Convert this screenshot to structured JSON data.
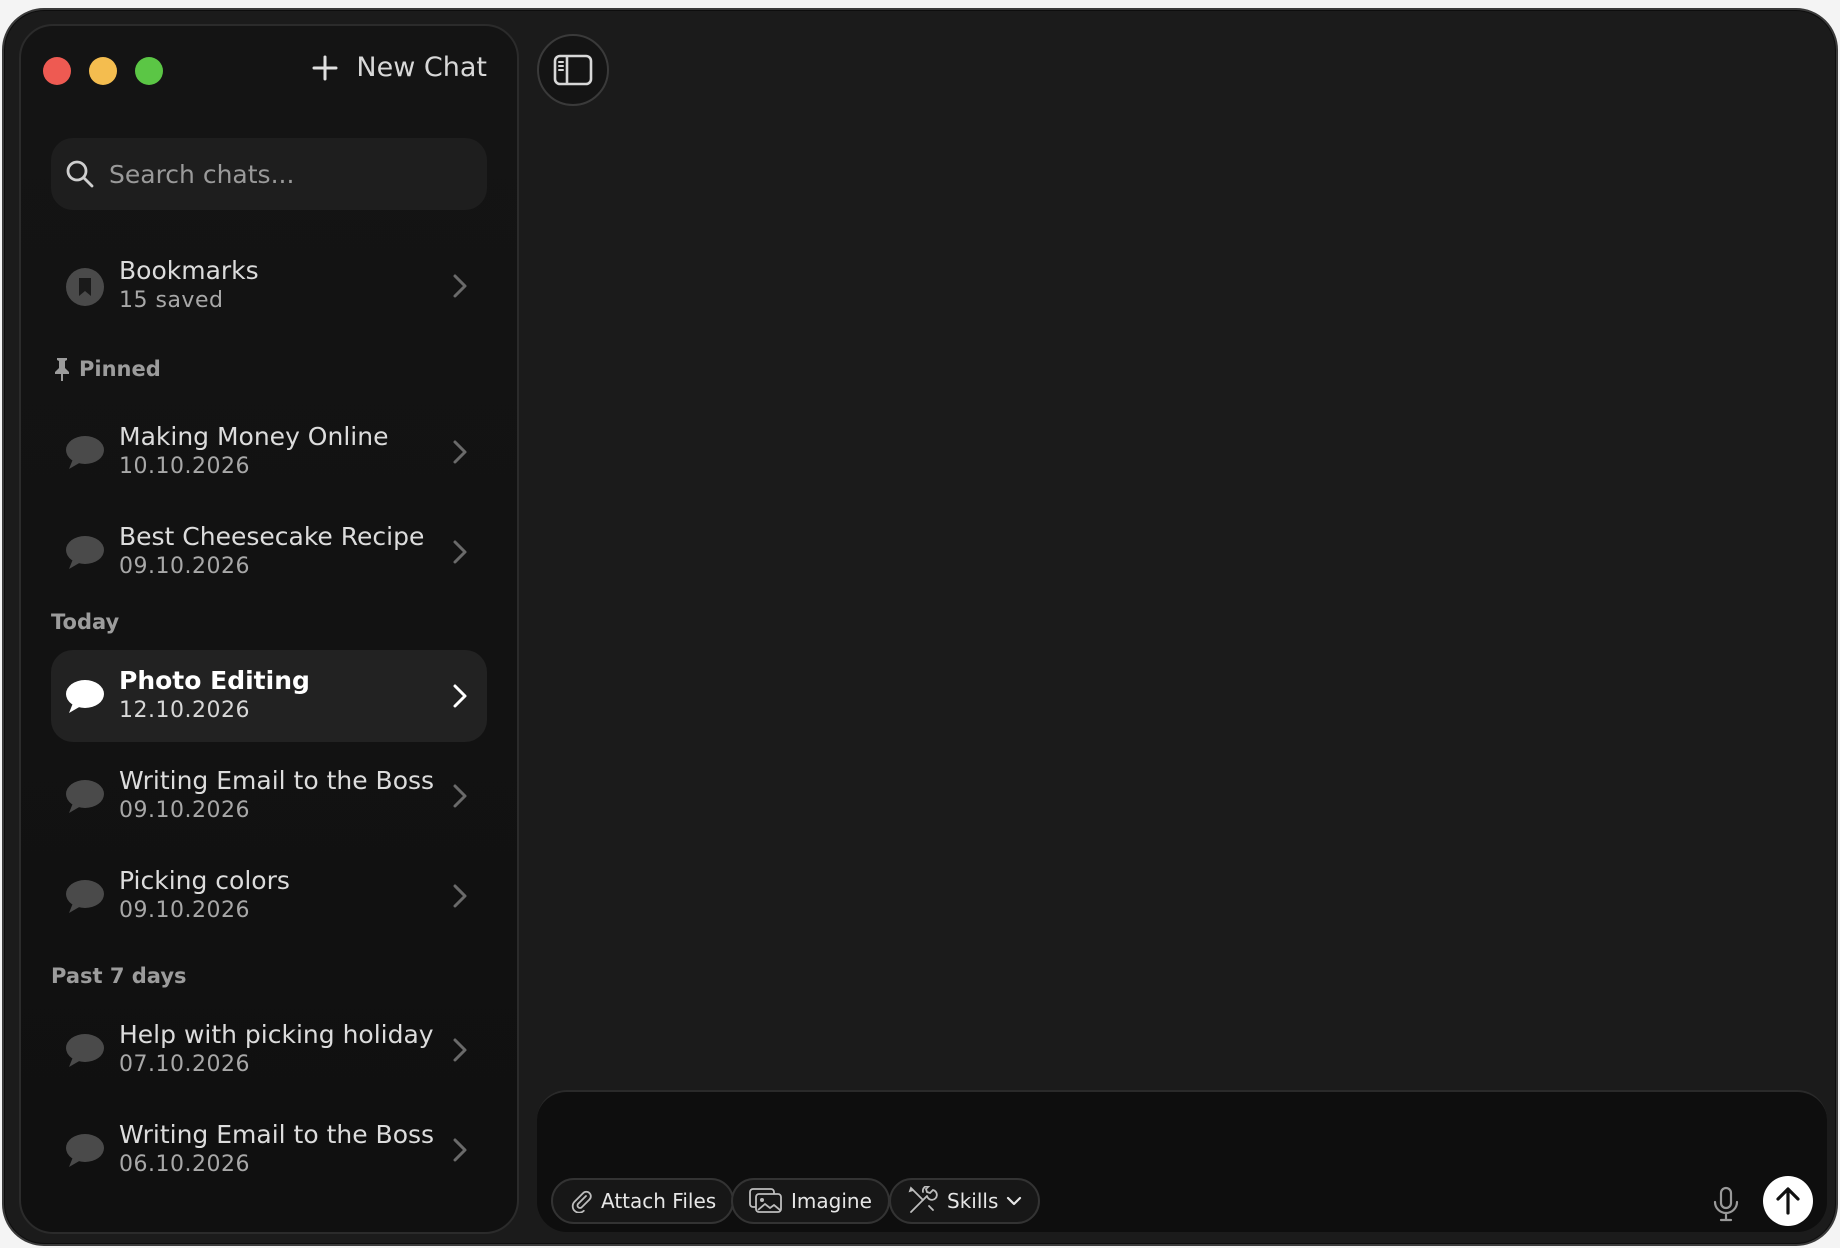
{
  "sidebar": {
    "new_chat_label": "New Chat",
    "search_placeholder": "Search chats...",
    "bookmarks": {
      "title": "Bookmarks",
      "sub": "15 saved"
    },
    "sections": {
      "pinned": "Pinned",
      "today": "Today",
      "past7": "Past 7 days"
    },
    "items": [
      {
        "title": "Making Money Online",
        "date": "10.10.2026"
      },
      {
        "title": "Best Cheesecake Recipe",
        "date": "09.10.2026"
      },
      {
        "title": "Photo Editing",
        "date": "12.10.2026"
      },
      {
        "title": "Writing Email to the Boss",
        "date": "09.10.2026"
      },
      {
        "title": "Picking colors",
        "date": "09.10.2026"
      },
      {
        "title": "Help with picking holiday",
        "date": "07.10.2026"
      },
      {
        "title": "Writing Email to the Boss",
        "date": "06.10.2026"
      }
    ]
  },
  "composer": {
    "attach_label": "Attach Files",
    "imagine_label": "Imagine",
    "skills_label": "Skills"
  },
  "colors": {
    "window_bg": "#1b1b1b",
    "sidebar_bg": "#121212",
    "active_item_bg": "#222222",
    "traffic_red": "#ee5a52",
    "traffic_yellow": "#f4bd4f",
    "traffic_green": "#5bc645"
  }
}
